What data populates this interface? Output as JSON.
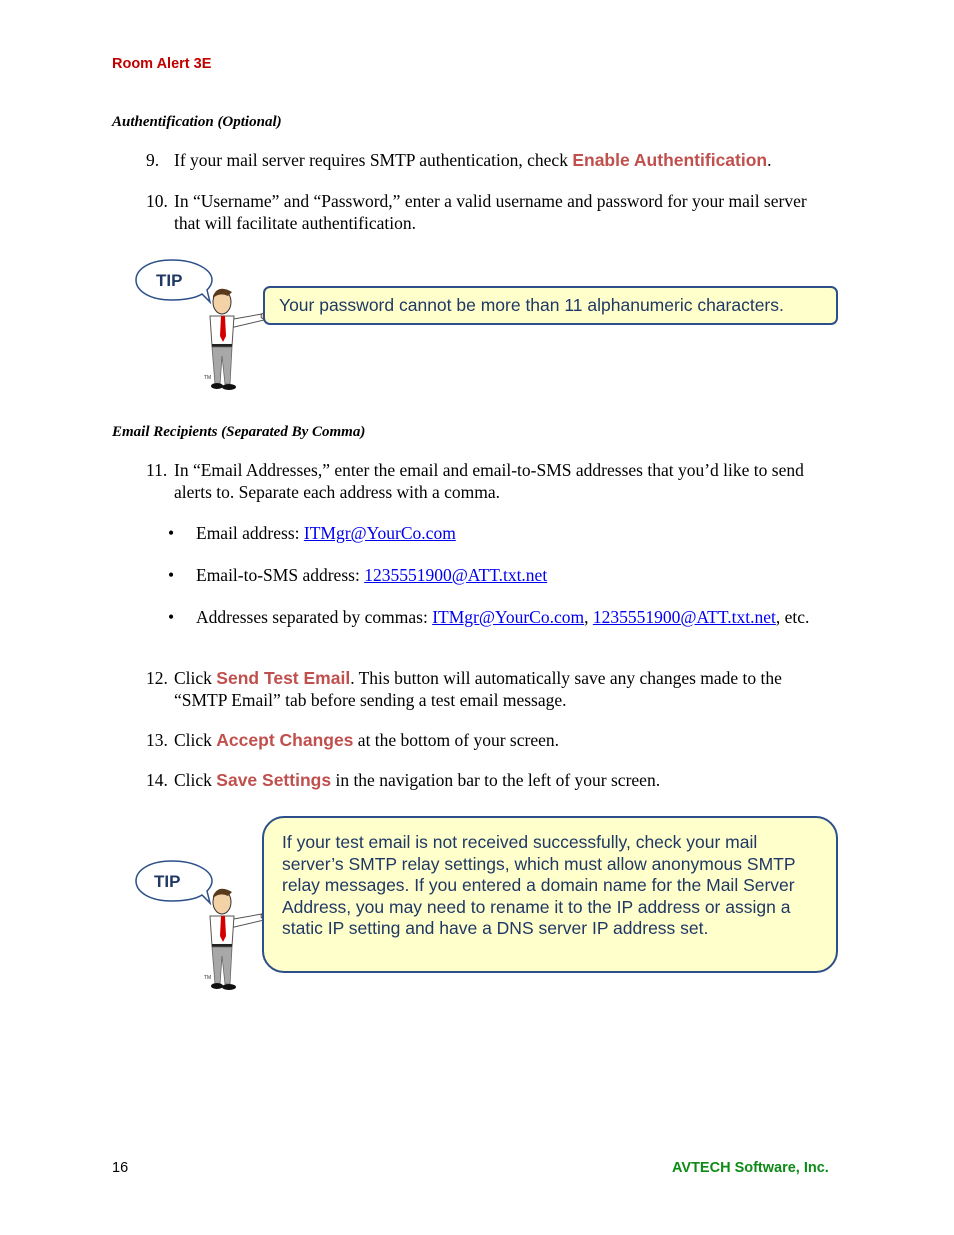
{
  "header": {
    "title": "Room Alert 3E"
  },
  "sections": {
    "auth": {
      "heading": "Authentification (Optional)",
      "steps": [
        {
          "num": "9.",
          "before": "If your mail server requires SMTP authentication, check ",
          "keyword": "Enable Authentification",
          "after": "."
        },
        {
          "num": "10.",
          "text": "In “Username” and “Password,” enter a valid username and password for your mail server that will facilitate authentification."
        }
      ],
      "tip": {
        "label": "TIP",
        "text": "Your password cannot be more than 11 alphanumeric characters."
      }
    },
    "recipients": {
      "heading": "Email Recipients (Separated By Comma)",
      "step11": {
        "num": "11.",
        "text": "In “Email Addresses,” enter the email and email-to-SMS addresses that you’d like to send alerts to. Separate each address with a comma."
      },
      "bullets": [
        {
          "label": "Email address: ",
          "links": [
            "ITMgr@YourCo.com"
          ]
        },
        {
          "label": "Email-to-SMS address: ",
          "links": [
            "1235551900@ATT.txt.net"
          ]
        },
        {
          "label": "Addresses separated by commas: ",
          "links": [
            "ITMgr@YourCo.com",
            "1235551900@ATT.txt.net"
          ],
          "suffix": ", etc."
        }
      ],
      "step12": {
        "num": "12.",
        "before": "Click ",
        "keyword": "Send Test Email",
        "after": ". This button will automatically save any changes made to the “SMTP Email” tab before sending a test email message."
      },
      "step13": {
        "num": "13.",
        "before": "Click ",
        "keyword": "Accept Changes",
        "after": " at the bottom of your screen."
      },
      "step14": {
        "num": "14.",
        "before": "Click ",
        "keyword": "Save Settings",
        "after": " in the navigation bar to the left of your screen."
      },
      "tip": {
        "label": "TIP",
        "text": "If your test email is not received successfully, check your mail server’s SMTP relay settings, which must allow anonymous SMTP relay messages. If you entered a domain name for the Mail Server Address, you may need to rename it to the IP address or assign a static IP setting and have a DNS server IP address set."
      }
    }
  },
  "footer": {
    "page_number": "16",
    "company": "AVTECH Software, Inc."
  },
  "colors": {
    "header_red": "#c00000",
    "keyword_red": "#c0504d",
    "tip_fill": "#ffffcc",
    "tip_border": "#2c4f8a",
    "tip_text": "#1f3864",
    "footer_green": "#0e8a16",
    "link_blue": "#0000ee"
  }
}
